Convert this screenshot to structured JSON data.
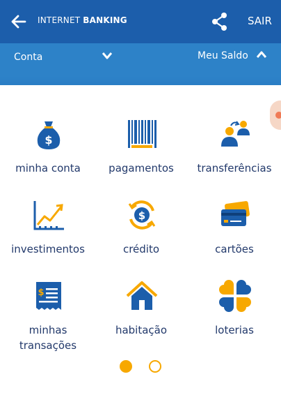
{
  "header": {
    "title_thin": "INTERNET",
    "title_bold": "BANKING",
    "exit_label": "SAIR"
  },
  "subbar": {
    "account_label": "Conta",
    "balance_label": "Meu Saldo"
  },
  "menu": {
    "items": [
      {
        "label": "minha conta",
        "icon": "money-bag-icon"
      },
      {
        "label": "pagamentos",
        "icon": "barcode-icon"
      },
      {
        "label": "transferências",
        "icon": "transfer-people-icon"
      },
      {
        "label": "investimentos",
        "icon": "growth-chart-icon"
      },
      {
        "label": "crédito",
        "icon": "credit-coin-icon"
      },
      {
        "label": "cartões",
        "icon": "cards-icon"
      },
      {
        "label": "minhas transações",
        "icon": "receipt-icon"
      },
      {
        "label": "habitação",
        "icon": "house-icon"
      },
      {
        "label": "loterias",
        "icon": "lottery-clover-icon"
      }
    ]
  },
  "pager": {
    "current_page": 1,
    "total_pages": 2
  },
  "colors": {
    "header_bg": "#1c5eab",
    "subbar_bg": "#2d82c8",
    "icon_blue": "#1c5eab",
    "icon_orange": "#f7a800",
    "label_text": "#22396b"
  }
}
